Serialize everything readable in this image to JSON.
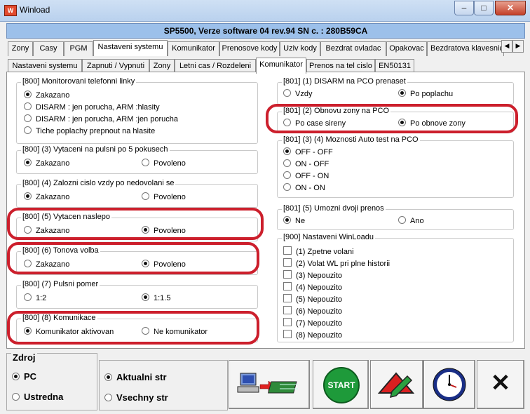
{
  "window": {
    "title": "Winload",
    "icon": "winload-app-icon",
    "min": "–",
    "max": "□",
    "close": "✕"
  },
  "banner": "SP5500, Verze software 04 rev.94 SN c. : 280B59CA",
  "tabs_main": [
    "Zony",
    "Casy",
    "PGM",
    "Nastaveni systemu",
    "Komunikator",
    "Prenosove kody",
    "Uziv kody",
    "Bezdrat ovladac",
    "Opakovac",
    "Bezdratova klavesnice"
  ],
  "tabs_main_active": 3,
  "tabs_sub": [
    "Nastaveni systemu",
    "Zapnuti / Vypnuti",
    "Zony",
    "Letni cas / Rozdeleni",
    "Komunikator",
    "Prenos na tel cislo",
    "EN50131"
  ],
  "tabs_sub_active": 4,
  "groups": {
    "monitor": {
      "legend": "[800]  Monitorovani telefonni linky",
      "options": [
        "Zakazano",
        "DISARM : jen porucha,  ARM :hlasity",
        "DISARM : jen porucha,  ARM :jen porucha",
        "Tiche poplachy prepnout na hlasite"
      ]
    },
    "pulsni5": {
      "legend": "[800] (3)  Vytaceni na pulsni po 5 pokusech",
      "a": "Zakazano",
      "b": "Povoleno"
    },
    "zalozni": {
      "legend": "[800] (4)  Zalozni cislo vzdy po nedovolani se",
      "a": "Zakazano",
      "b": "Povoleno"
    },
    "naslepo": {
      "legend": "[800] (5)  Vytacen naslepo",
      "a": "Zakazano",
      "b": "Povoleno"
    },
    "tonova": {
      "legend": "[800] (6)  Tonova volba",
      "a": "Zakazano",
      "b": "Povoleno"
    },
    "pulsnipomer": {
      "legend": "[800] (7)  Pulsni pomer",
      "a": "1:2",
      "b": "1:1.5"
    },
    "komunikace": {
      "legend": "[800] (8)  Komunikace",
      "a": "Komunikator aktivovan",
      "b": "Ne komunikator"
    },
    "disarm": {
      "legend": "[801] (1)  DISARM na PCO prenaset",
      "a": "Vzdy",
      "b": "Po poplachu"
    },
    "obnova": {
      "legend": "[801] (2)  Obnovu zony na PCO",
      "a": "Po case sireny",
      "b": "Po obnove zony"
    },
    "autotest": {
      "legend": "[801]   (3) (4) Moznosti Auto test na PCO",
      "options": [
        "OFF - OFF",
        "ON - OFF",
        "OFF - ON",
        "ON - ON"
      ]
    },
    "dvoji": {
      "legend": "[801] (5)  Umozni dvoji prenos",
      "a": "Ne",
      "b": "Ano"
    },
    "winload": {
      "legend": "[900]  Nastaveni WinLoadu",
      "options": [
        "(1) Zpetne volani",
        "(2) Volat WL pri plne historii",
        "(3) Nepouzito",
        "(4) Nepouzito",
        "(5) Nepouzito",
        "(6) Nepouzito",
        "(7) Nepouzito",
        "(8) Nepouzito"
      ]
    }
  },
  "bottom": {
    "zdroj_label": "Zdroj",
    "zdroj_opts": [
      "PC",
      "Ustredna"
    ],
    "str_opts": [
      "Aktualni str",
      "Vsechny str"
    ],
    "start_label": "START",
    "transfer_icon": "pc-to-panel-transfer-icon",
    "edit_icon": "edit-pencil-icon",
    "clock_icon": "clock-icon",
    "close_icon": "close-x-icon",
    "close_glyph": "✕"
  },
  "colors": {
    "highlight": "#cc1f2c",
    "banner": "#9cc0ea",
    "start": "#1e9a3a"
  }
}
